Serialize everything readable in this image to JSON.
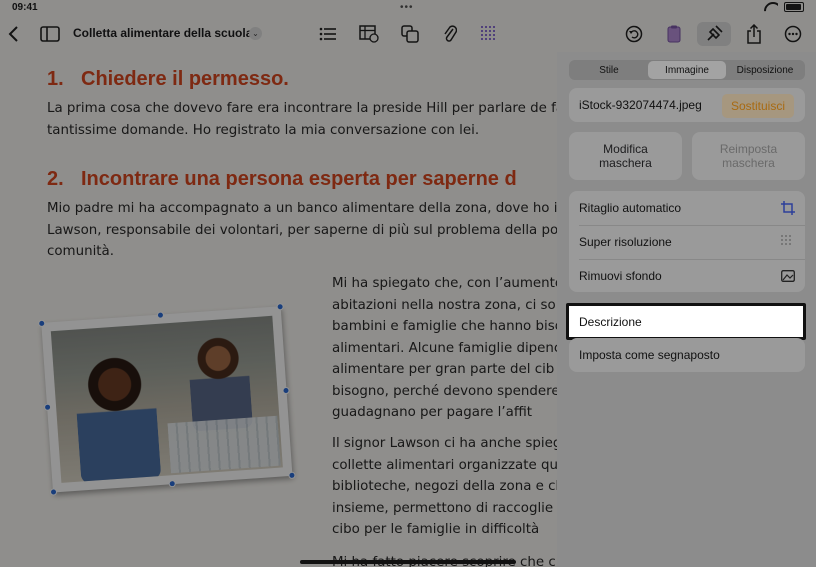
{
  "status": {
    "time": "09:41"
  },
  "toolbar": {
    "back_icon": "chevron-left-icon",
    "sidebar_icon": "sidebar-icon",
    "title": "Colletta alimentare della scuola",
    "title_chevron": "⌄"
  },
  "document": {
    "section1": {
      "number": "1.",
      "heading": "Chiedere il permesso."
    },
    "para1": "La prima cosa che dovevo fare era incontrare la preside Hill per parlare de fatto tantissime domande. Ho registrato la mia conversazione con lei.",
    "section2": {
      "number": "2.",
      "heading": "Incontrare una persona esperta per saperne d"
    },
    "para2": "Mio padre mi ha accompagnato a un banco alimentare della zona, dove ho in Lawson, responsabile dei volontari, per saperne di più sul problema della po comunità.",
    "para3": "Mi ha spiegato che, con l’aumento abitazioni nella nostra zona, ci so bambini e famiglie che hanno biso alimentari. Alcune famiglie dipenc alimentare per gran parte del cib bisogno, perché devono spendere che guadagnano per pagare l’affit",
    "para4": "Il signor Lawson ci ha anche spieg collette alimentari organizzate qu biblioteche, negozi della zona e ch insieme, permettono di raccoglie di cibo per le famiglie in difficoltà",
    "para5_partial": "Mi ha fatto piacere scoprire che c"
  },
  "inspector": {
    "tabs": [
      "Stile",
      "Immagine",
      "Disposizione"
    ],
    "selected_tab": "Immagine",
    "file_name": "iStock-932074474.jpeg",
    "replace_label": "Sostituisci",
    "edit_mask_line1": "Modifica",
    "edit_mask_line2": "maschera",
    "reset_mask_line1": "Reimposta",
    "reset_mask_line2": "maschera",
    "rows": {
      "auto_crop": "Ritaglio automatico",
      "super_res": "Super risoluzione",
      "remove_bg": "Rimuovi sfondo"
    },
    "description": "Descrizione",
    "placeholder": "Imposta come segnaposto"
  },
  "colors": {
    "heading": "#d9481f",
    "accent": "#a86a12",
    "focus_border": "#111111"
  }
}
